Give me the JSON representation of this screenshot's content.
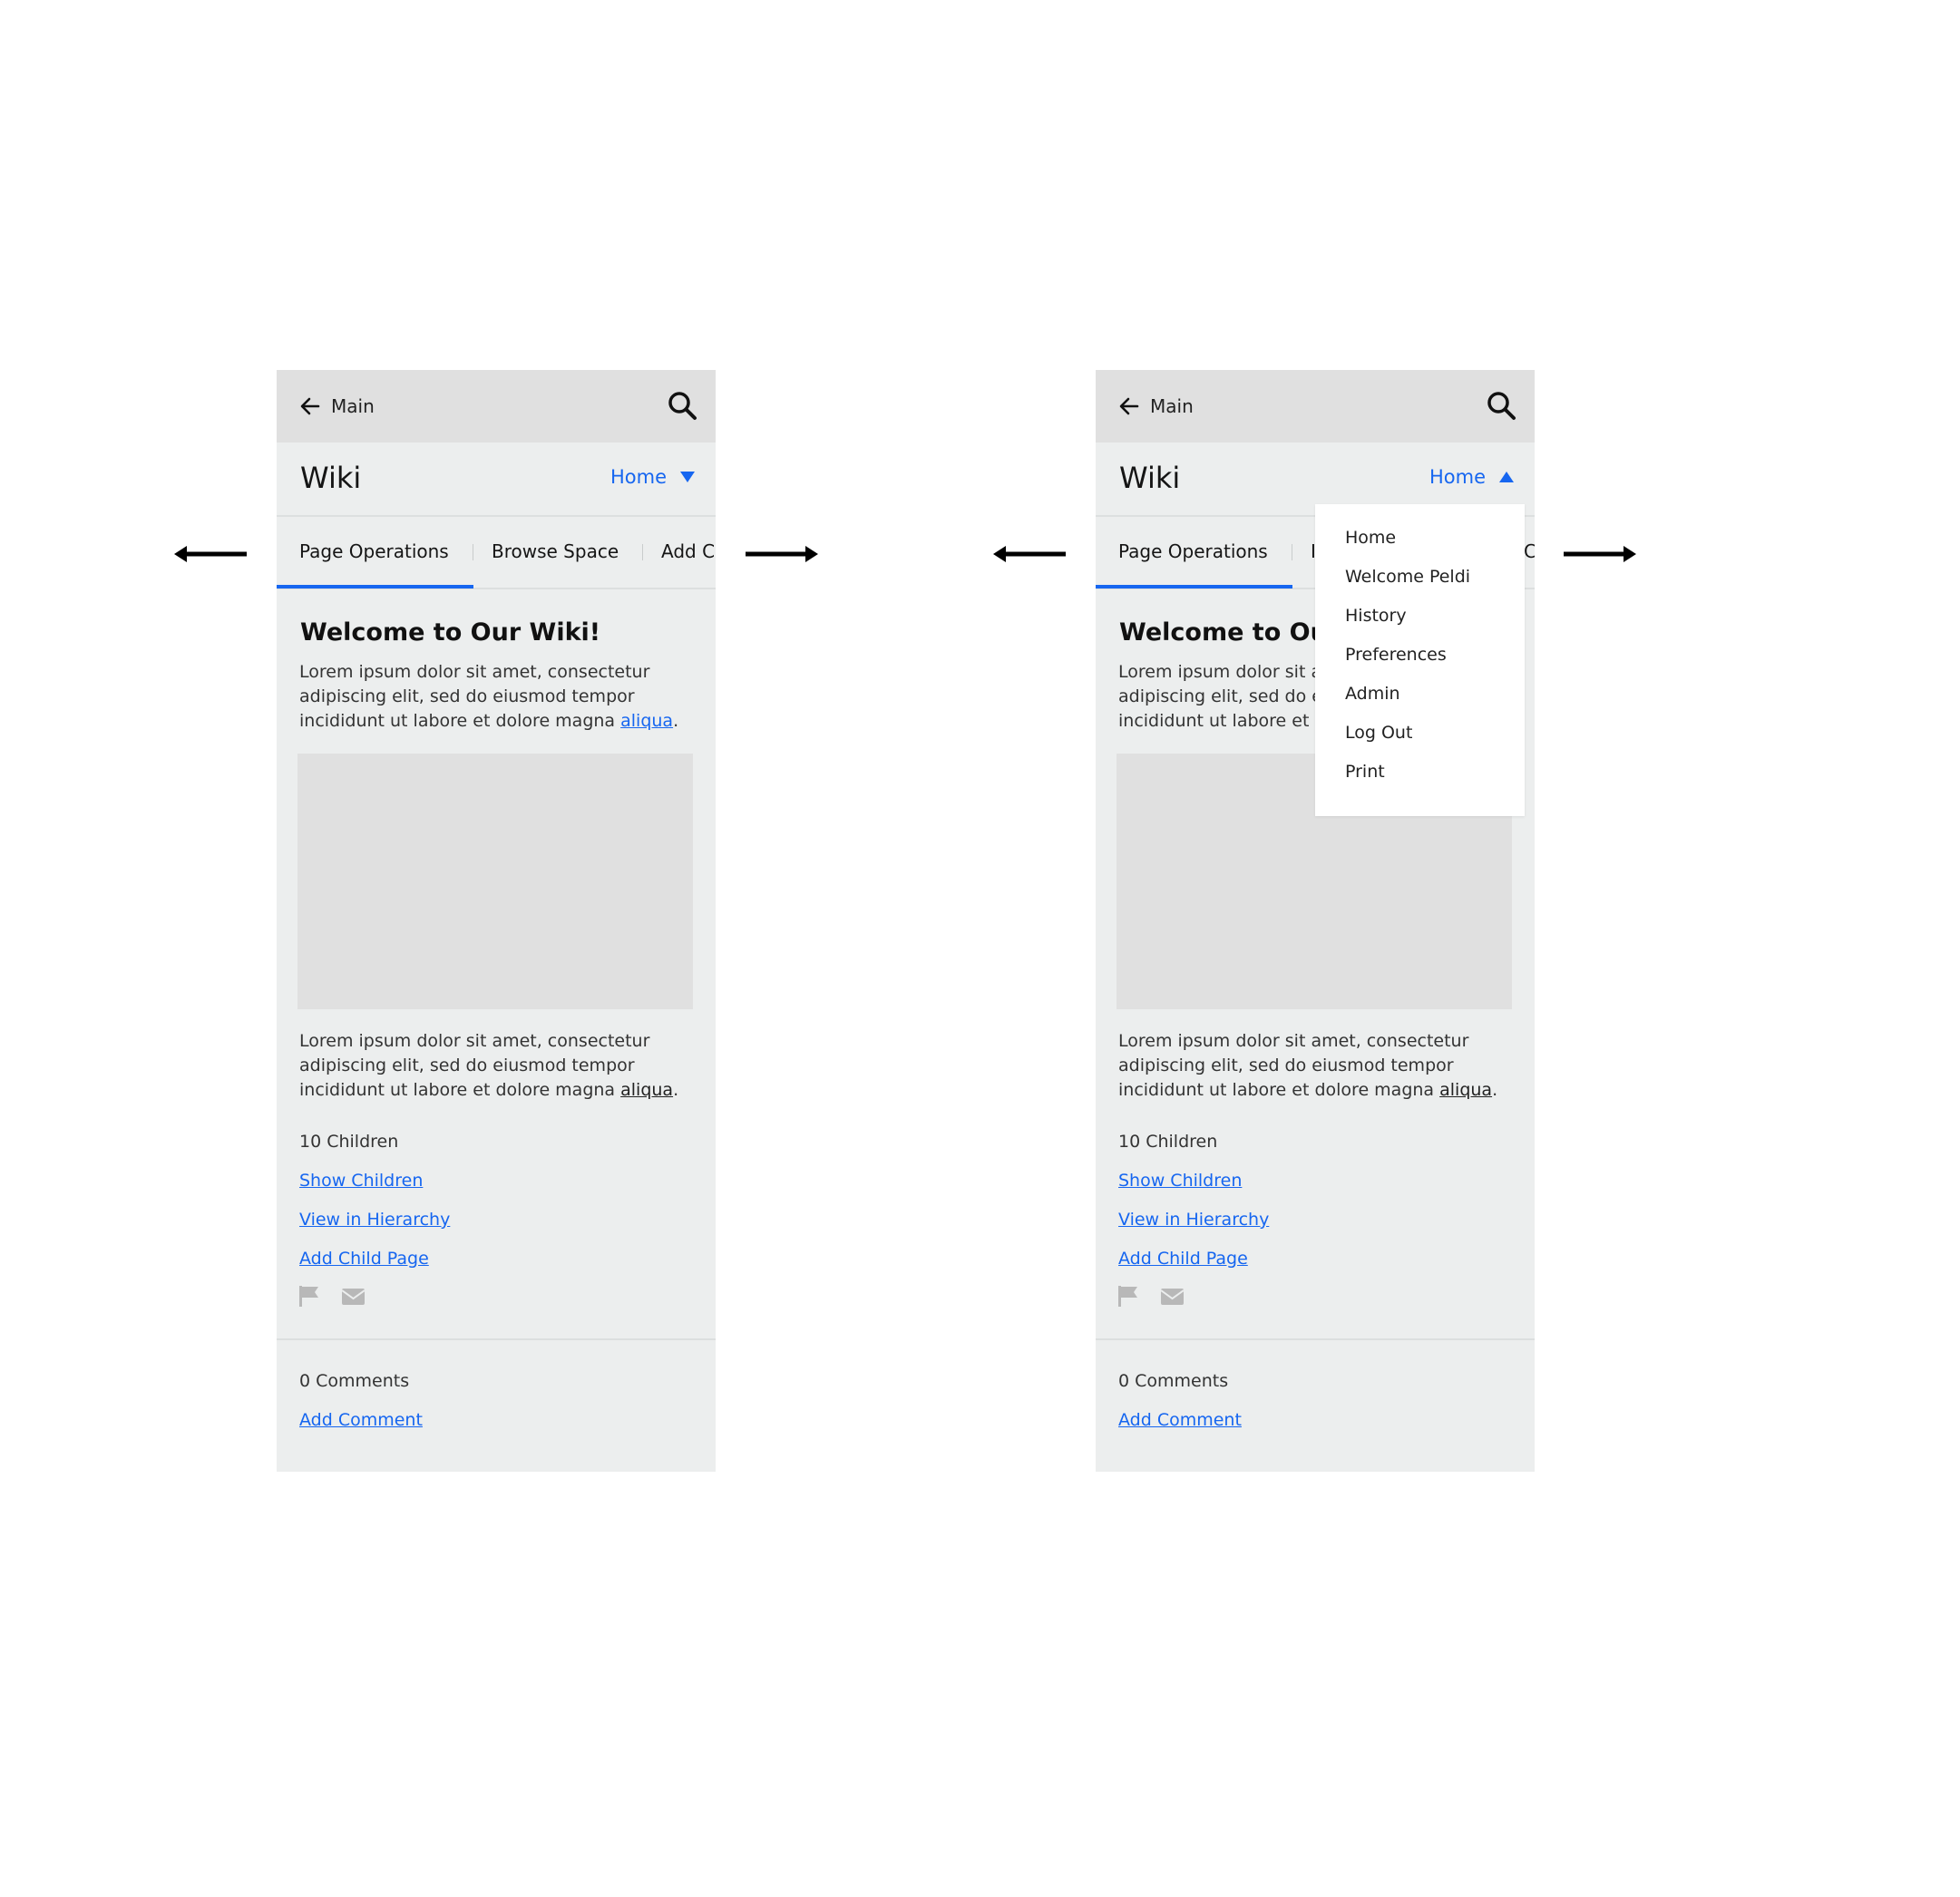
{
  "header": {
    "back_label": "Main",
    "search_icon": "search-icon",
    "back_icon": "arrow-left-icon"
  },
  "title_bar": {
    "title": "Wiki",
    "dropdown_label": "Home"
  },
  "tabs": [
    "Page Operations",
    "Browse Space",
    "Add C"
  ],
  "tabs_truncated_right": {
    "left_fragment": "I",
    "right_fragment": "C"
  },
  "page": {
    "heading": "Welcome to Our Wiki!",
    "heading_truncated": "Welcome to Our",
    "intro_text": "Lorem ipsum dolor sit amet, consectetur adipiscing elit, sed do eiusmod tempor incididunt ut labore et dolore magna",
    "intro_link": "aliqua",
    "intro_lines_truncated": [
      "Lorem ipsum dolor sit a",
      "adipiscing elit, sed do e",
      "incididunt ut labore et c"
    ],
    "body_text": "Lorem ipsum dolor sit amet, consectetur adipiscing elit, sed do eiusmod tempor incididunt ut labore et dolore magna",
    "body_link": "aliqua",
    "children_count": "10 Children",
    "links": [
      "Show Children",
      "View in Hierarchy",
      "Add Child Page"
    ],
    "icons": [
      "flag-icon",
      "envelope-icon"
    ],
    "comments_count": "0 Comments",
    "add_comment": "Add Comment"
  },
  "dropdown_menu": {
    "items": [
      "Home",
      "Welcome Peldi",
      "History",
      "Preferences",
      "Admin",
      "Log Out",
      "Print"
    ]
  },
  "colors": {
    "accent": "#1666f0",
    "panel": "#eceeee",
    "topbar": "#e0e0e0",
    "placeholder": "#e0e0e0"
  }
}
